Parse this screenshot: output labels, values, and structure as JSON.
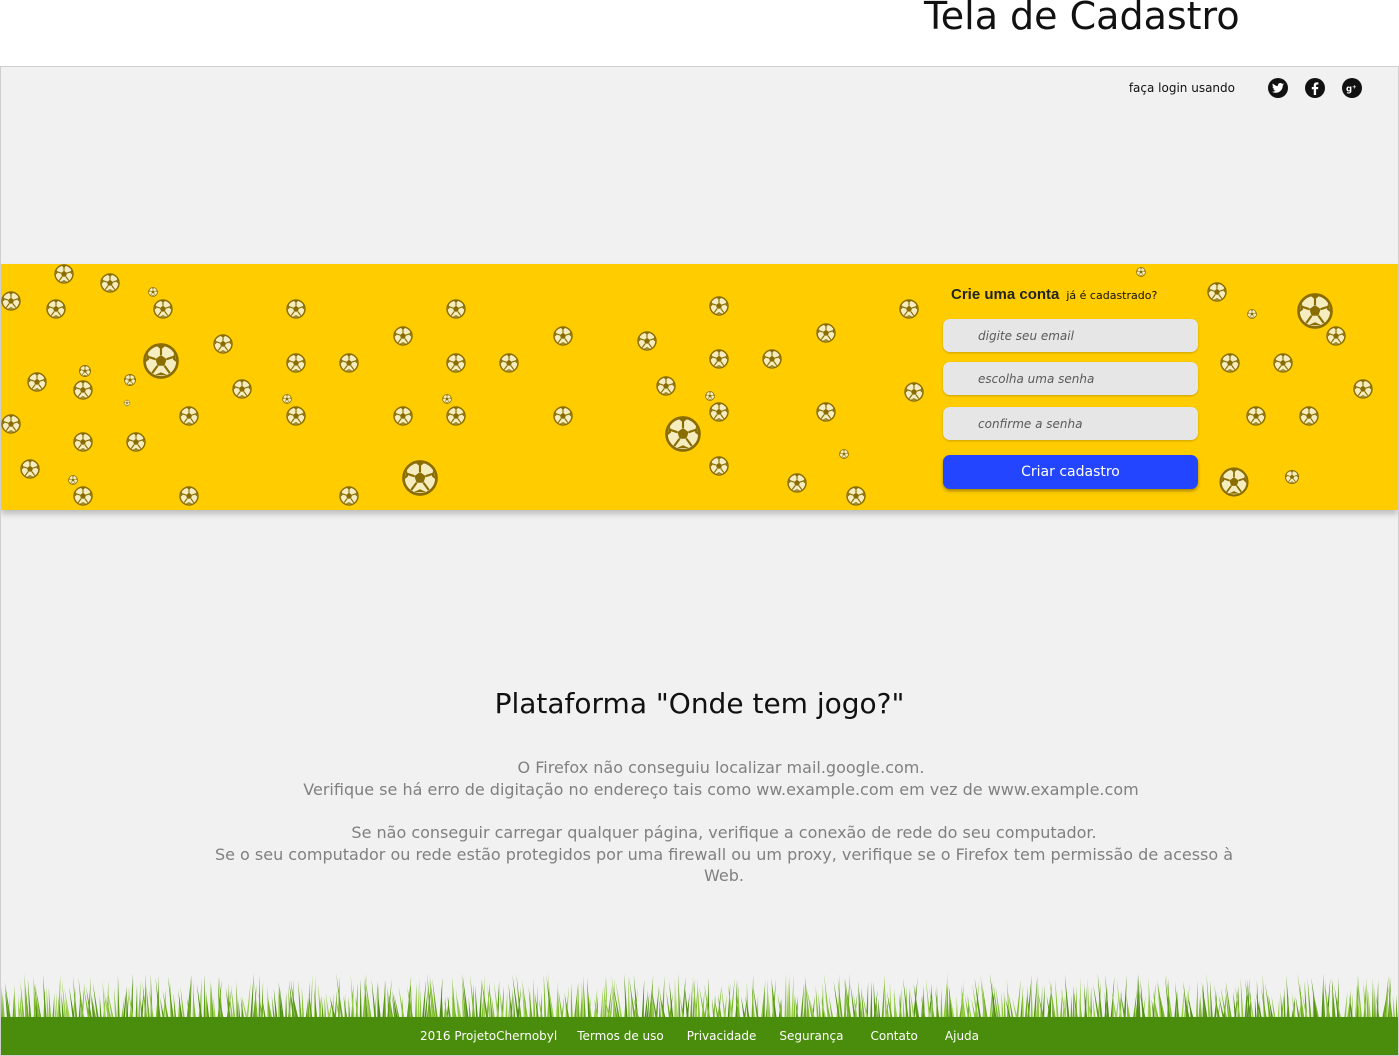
{
  "page": {
    "heading": "Tela de Cadastro"
  },
  "social_login": {
    "label": "faça login usando",
    "icons": [
      "twitter-icon",
      "facebook-icon",
      "google-plus-icon"
    ]
  },
  "signup_form": {
    "title": "Crie uma conta",
    "login_link": "já é cadastrado?",
    "email_placeholder": "digite seu email",
    "password_placeholder": "escolha uma senha",
    "confirm_placeholder": "confirme a senha",
    "submit_label": "Criar cadastro"
  },
  "content": {
    "title": "Plataforma \"Onde tem jogo?\"",
    "error_line1": "O Firefox não conseguiu localizar mail.google.com.",
    "error_line2": "Verifique se há erro de digitação no endereço tais como  ww.example.com em vez de  www.example.com",
    "error_line3": "Se não conseguir carregar qualquer página, verifique a conexão de rede  do seu computador.",
    "error_line4": "Se o seu computador ou rede estão protegidos por uma firewall ou um proxy, verifique se o Firefox tem permissão de acesso à Web."
  },
  "footer": {
    "copyright": "2016 ProjetoChernobyl",
    "links": [
      "Termos de uso",
      "Privacidade",
      "Segurança",
      "Contato",
      "Ajuda"
    ]
  },
  "colors": {
    "banner": "#ffcc00",
    "button": "#2445ff",
    "footer": "#4a8c0b",
    "ball": "#9a7a00"
  }
}
